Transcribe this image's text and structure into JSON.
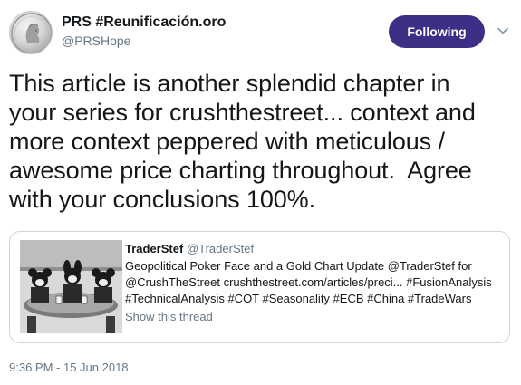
{
  "author": {
    "display_name": "PRS #Reunificación.oro",
    "handle": "@PRSHope",
    "avatar_icon": "coin-portrait-icon"
  },
  "follow_button": {
    "label": "Following",
    "color": "#3b2f86"
  },
  "menu": {
    "icon": "chevron-down-icon"
  },
  "tweet": {
    "text": "This article is another splendid chapter in\nyour series for crushthestreet... context and\nmore context peppered with meticulous /\nawesome price charting throughout.  Agree\nwith your conclusions 100%."
  },
  "quoted_tweet": {
    "name": "TraderStef",
    "handle": "@TraderStef",
    "text_lines": [
      "Geopolitical Poker Face and a Gold Chart Update @TraderStef for",
      "@CrushTheStreet crushthestreet.com/articles/preci... #FusionAnalysis",
      "#TechnicalAnalysis #COT #Seasonality #ECB #China #TradeWars"
    ],
    "thread_link": "Show this thread",
    "image_icon": "cartoon-poker-image"
  },
  "timestamp": "9:36 PM - 15 Jun 2018",
  "colors": {
    "text": "#14171a",
    "secondary": "#657786",
    "border": "#ccd6dd"
  }
}
